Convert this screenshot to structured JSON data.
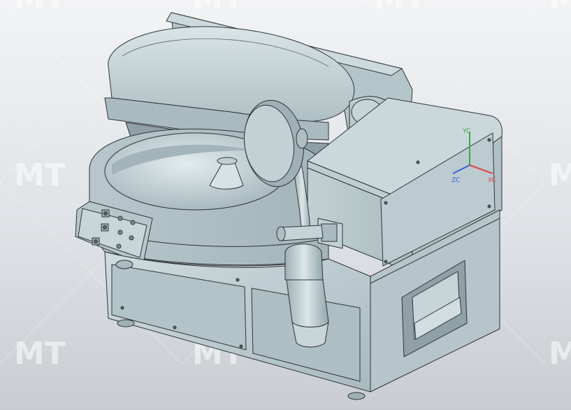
{
  "viewport": {
    "background_top": "#f2f3f5",
    "background_bottom": "#c9ccd1"
  },
  "watermark": {
    "text": "MT"
  },
  "model": {
    "body_color": "#b9c9cd",
    "edge_color": "#2f3436",
    "highlight_color": "#d6e2e4",
    "shadow_color": "#8fa1a6"
  },
  "triad": {
    "y_label": "YC",
    "z_label": "ZC",
    "x_label": "XC",
    "x_color": "#e04848",
    "y_color": "#3aa84a",
    "z_color": "#3b5fd8"
  }
}
